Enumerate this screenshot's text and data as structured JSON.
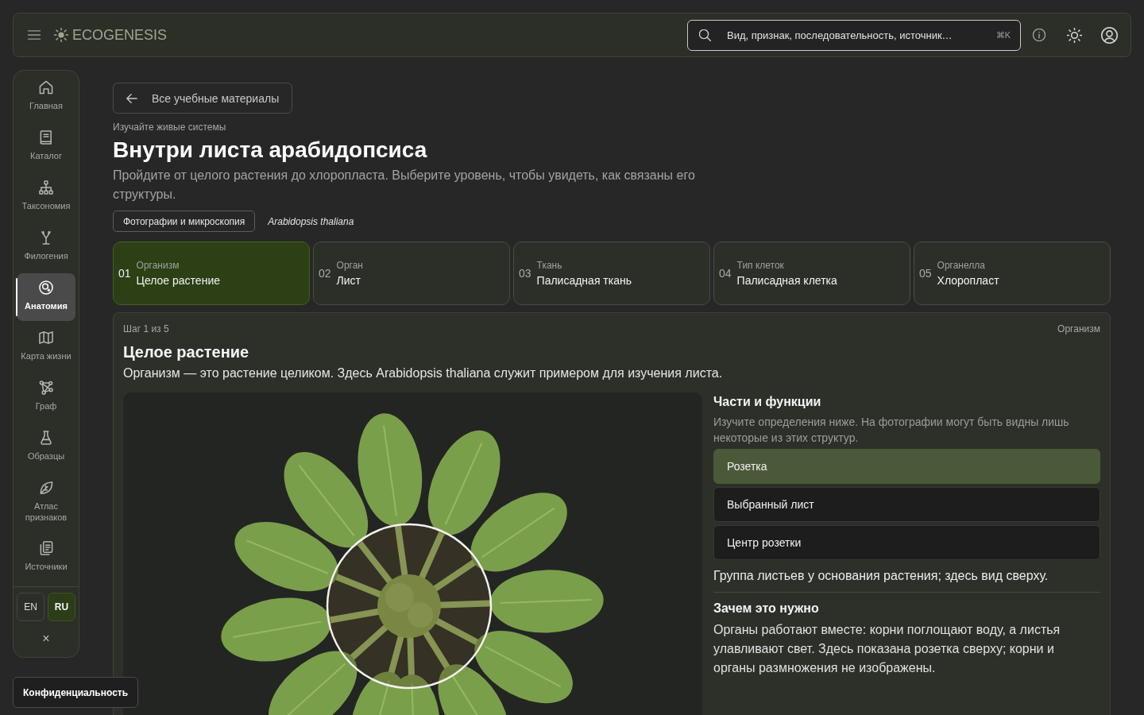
{
  "top_bar": {
    "brand": "ECOGENESIS",
    "search": {
      "placeholder": "Вид, признак, последовательность, источник…",
      "shortcut": "⌘K"
    }
  },
  "sidebar": {
    "items": [
      {
        "label": "Главная",
        "selected": false
      },
      {
        "label": "Каталог",
        "selected": false
      },
      {
        "label": "Таксономия",
        "selected": false
      },
      {
        "label": "Филогения",
        "selected": false
      },
      {
        "label": "Анатомия",
        "selected": true
      },
      {
        "label": "Карта жизни",
        "selected": false
      },
      {
        "label": "Граф",
        "selected": false
      },
      {
        "label": "Образцы",
        "selected": false
      },
      {
        "label": "Атлас признаков",
        "selected": false
      },
      {
        "label": "Источники",
        "selected": false
      }
    ],
    "languages": [
      {
        "label": "EN",
        "selected": false
      },
      {
        "label": "RU",
        "selected": true
      }
    ],
    "close": "×"
  },
  "back_link": "Все учебные материалы",
  "eyebrow": "Изучайте живые системы",
  "title": "Внутри листа арабидопсиса",
  "description": "Пройдите от целого растения до хлоропласта. Выберите уровень, чтобы увидеть, как связаны его структуры.",
  "tags": [
    {
      "label": "Фотографии и микроскопия",
      "kind": "chip"
    },
    {
      "label": "Arabidopsis thaliana",
      "kind": "species"
    }
  ],
  "steps": [
    {
      "number": "01",
      "level": "Организм",
      "title": "Целое растение",
      "selected": true
    },
    {
      "number": "02",
      "level": "Орган",
      "title": "Лист",
      "selected": false
    },
    {
      "number": "03",
      "level": "Ткань",
      "title": "Палисадная ткань",
      "selected": false
    },
    {
      "number": "04",
      "level": "Тип клеток",
      "title": "Палисадная клетка",
      "selected": false
    },
    {
      "number": "05",
      "level": "Органелла",
      "title": "Хлоропласт",
      "selected": false
    }
  ],
  "step_panel": {
    "counter": "Шаг 1 из 5",
    "level": "Организм",
    "title": "Целое растение",
    "description": "Организм — это растение целиком. Здесь Arabidopsis thaliana служит примером для изучения листа.",
    "parts": {
      "title": "Части и функции",
      "hint": "Изучите определения ниже. На фотографии могут быть видны лишь некоторые из этих структур.",
      "items": [
        {
          "label": "Розетка",
          "selected": true
        },
        {
          "label": "Выбранный лист",
          "selected": false
        },
        {
          "label": "Центр розетки",
          "selected": false
        }
      ],
      "definition": "Группа листьев у основания растения; здесь вид сверху."
    },
    "why": {
      "title": "Зачем это нужно",
      "text": "Органы работают вместе: корни поглощают воду, а листья улавливают свет. Здесь показана розетка сверху; корни и органы размножения не изображены."
    }
  },
  "privacy_button": "Конфиденциальность"
}
